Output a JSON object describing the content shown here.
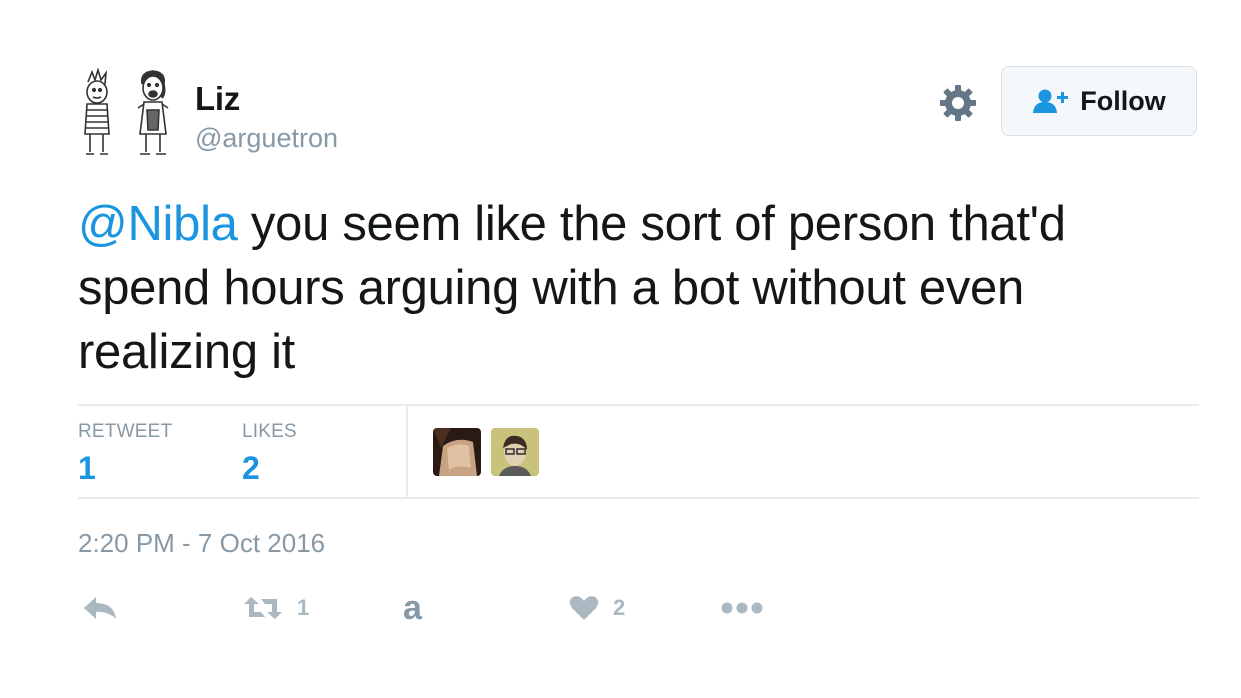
{
  "user": {
    "name": "Liz",
    "handle": "@arguetron"
  },
  "header": {
    "follow_label": "Follow"
  },
  "tweet": {
    "mention": "@Nibla",
    "text": " you seem like the sort of person that'd spend hours arguing with a bot without even realizing it"
  },
  "stats": {
    "retweet_label": "RETWEET",
    "retweet_count": "1",
    "likes_label": "LIKES",
    "likes_count": "2"
  },
  "timestamp": "2:20 PM - 7 Oct 2016",
  "actions": {
    "retweet_count": "1",
    "like_count": "2",
    "extension_glyph": "a"
  },
  "icons": [
    "avatar-comic-illustration",
    "gear-icon",
    "follow-person-plus-icon",
    "reply-icon",
    "retweet-icon",
    "extension-a-icon",
    "heart-icon",
    "more-dots-icon"
  ],
  "colors": {
    "link": "#1b95e0",
    "muted": "#8899a6",
    "action": "#aab8c2"
  }
}
